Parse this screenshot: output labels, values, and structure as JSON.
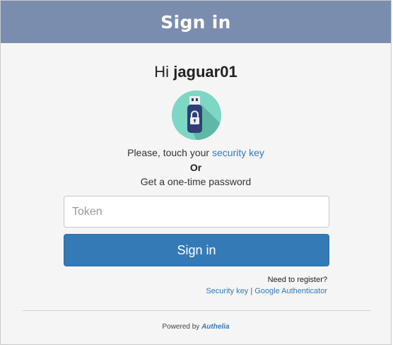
{
  "header": {
    "title": "Sign in"
  },
  "greeting": {
    "prefix": "Hi",
    "username": "jaguar01"
  },
  "icon": {
    "name": "usb-security-key-icon",
    "circle_color": "#7ed6c4",
    "shadow_color": "#5fb8a7",
    "body_color": "#2f3f73"
  },
  "prompt": {
    "text": "Please, touch your",
    "link": "security key",
    "or": "Or",
    "otp": "Get a one-time password"
  },
  "form": {
    "token_placeholder": "Token",
    "submit_label": "Sign in"
  },
  "register": {
    "question": "Need to register?",
    "security_key_link": "Security key",
    "separator": "|",
    "google_authenticator_link": "Google Authenticator"
  },
  "footer": {
    "powered_by": "Powered by",
    "brand": "Authelia"
  },
  "colors": {
    "header_bg": "#7b8daf",
    "primary": "#337ab7",
    "card_bg": "#f5f5f5"
  }
}
